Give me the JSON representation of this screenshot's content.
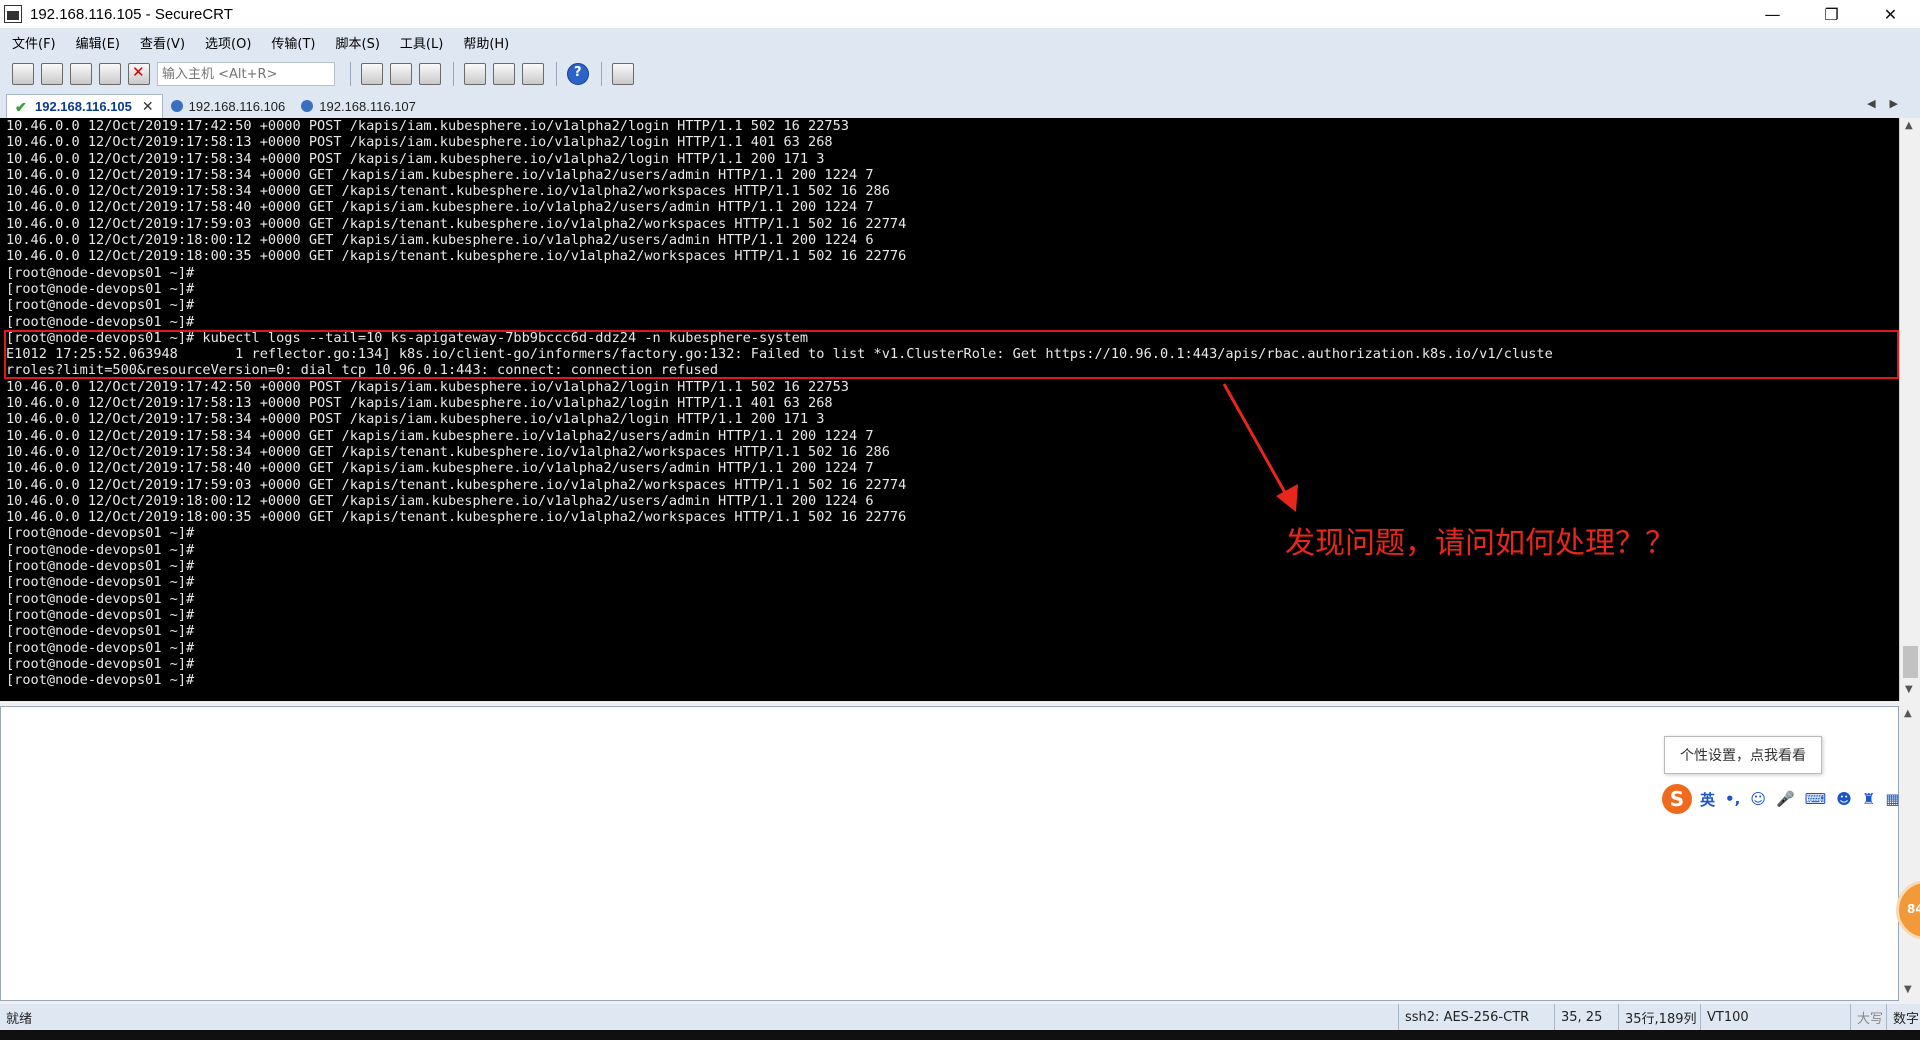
{
  "window": {
    "title": "192.168.116.105 - SecureCRT",
    "controls": [
      "—",
      "❐",
      "✕"
    ]
  },
  "menu": [
    "文件(F)",
    "编辑(E)",
    "查看(V)",
    "选项(O)",
    "传输(T)",
    "脚本(S)",
    "工具(L)",
    "帮助(H)"
  ],
  "toolbar": {
    "host_placeholder": "输入主机 <Alt+R>"
  },
  "tabs": [
    {
      "label": "192.168.116.105",
      "active": true,
      "close": "✕"
    },
    {
      "label": "192.168.116.106",
      "active": false
    },
    {
      "label": "192.168.116.107",
      "active": false
    }
  ],
  "terminal": {
    "lines": [
      "10.46.0.0 12/Oct/2019:17:42:50 +0000 POST /kapis/iam.kubesphere.io/v1alpha2/login HTTP/1.1 502 16 22753",
      "10.46.0.0 12/Oct/2019:17:58:13 +0000 POST /kapis/iam.kubesphere.io/v1alpha2/login HTTP/1.1 401 63 268",
      "10.46.0.0 12/Oct/2019:17:58:34 +0000 POST /kapis/iam.kubesphere.io/v1alpha2/login HTTP/1.1 200 171 3",
      "10.46.0.0 12/Oct/2019:17:58:34 +0000 GET /kapis/iam.kubesphere.io/v1alpha2/users/admin HTTP/1.1 200 1224 7",
      "10.46.0.0 12/Oct/2019:17:58:34 +0000 GET /kapis/tenant.kubesphere.io/v1alpha2/workspaces HTTP/1.1 502 16 286",
      "10.46.0.0 12/Oct/2019:17:58:40 +0000 GET /kapis/iam.kubesphere.io/v1alpha2/users/admin HTTP/1.1 200 1224 7",
      "10.46.0.0 12/Oct/2019:17:59:03 +0000 GET /kapis/tenant.kubesphere.io/v1alpha2/workspaces HTTP/1.1 502 16 22774",
      "10.46.0.0 12/Oct/2019:18:00:12 +0000 GET /kapis/iam.kubesphere.io/v1alpha2/users/admin HTTP/1.1 200 1224 6",
      "10.46.0.0 12/Oct/2019:18:00:35 +0000 GET /kapis/tenant.kubesphere.io/v1alpha2/workspaces HTTP/1.1 502 16 22776",
      "[root@node-devops01 ~]#",
      "[root@node-devops01 ~]#",
      "[root@node-devops01 ~]#",
      "[root@node-devops01 ~]#",
      "[root@node-devops01 ~]# kubectl logs --tail=10 ks-apigateway-7bb9bccc6d-ddz24 -n kubesphere-system",
      "E1012 17:25:52.063948       1 reflector.go:134] k8s.io/client-go/informers/factory.go:132: Failed to list *v1.ClusterRole: Get https://10.96.0.1:443/apis/rbac.authorization.k8s.io/v1/cluste",
      "rroles?limit=500&resourceVersion=0: dial tcp 10.96.0.1:443: connect: connection refused",
      "10.46.0.0 12/Oct/2019:17:42:50 +0000 POST /kapis/iam.kubesphere.io/v1alpha2/login HTTP/1.1 502 16 22753",
      "10.46.0.0 12/Oct/2019:17:58:13 +0000 POST /kapis/iam.kubesphere.io/v1alpha2/login HTTP/1.1 401 63 268",
      "10.46.0.0 12/Oct/2019:17:58:34 +0000 POST /kapis/iam.kubesphere.io/v1alpha2/login HTTP/1.1 200 171 3",
      "10.46.0.0 12/Oct/2019:17:58:34 +0000 GET /kapis/iam.kubesphere.io/v1alpha2/users/admin HTTP/1.1 200 1224 7",
      "10.46.0.0 12/Oct/2019:17:58:34 +0000 GET /kapis/tenant.kubesphere.io/v1alpha2/workspaces HTTP/1.1 502 16 286",
      "10.46.0.0 12/Oct/2019:17:58:40 +0000 GET /kapis/iam.kubesphere.io/v1alpha2/users/admin HTTP/1.1 200 1224 7",
      "10.46.0.0 12/Oct/2019:17:59:03 +0000 GET /kapis/tenant.kubesphere.io/v1alpha2/workspaces HTTP/1.1 502 16 22774",
      "10.46.0.0 12/Oct/2019:18:00:12 +0000 GET /kapis/iam.kubesphere.io/v1alpha2/users/admin HTTP/1.1 200 1224 6",
      "10.46.0.0 12/Oct/2019:18:00:35 +0000 GET /kapis/tenant.kubesphere.io/v1alpha2/workspaces HTTP/1.1 502 16 22776",
      "[root@node-devops01 ~]#",
      "[root@node-devops01 ~]#",
      "[root@node-devops01 ~]#",
      "[root@node-devops01 ~]#",
      "[root@node-devops01 ~]#",
      "[root@node-devops01 ~]#",
      "[root@node-devops01 ~]#",
      "[root@node-devops01 ~]#",
      "[root@node-devops01 ~]#",
      "[root@node-devops01 ~]#"
    ]
  },
  "annotation": {
    "text": "发现问题，请问如何处理？？",
    "color": "#e8261c"
  },
  "ime": {
    "tooltip": "个性设置，点我看看",
    "logo": "S",
    "mode": "英",
    "punct": "•,",
    "float_badge": "84"
  },
  "status": {
    "ready": "就绪",
    "cipher": "ssh2: AES-256-CTR",
    "cursor": "35,  25",
    "size": "35行,189列",
    "term": "VT100",
    "caps": "大写",
    "num": "数字"
  }
}
